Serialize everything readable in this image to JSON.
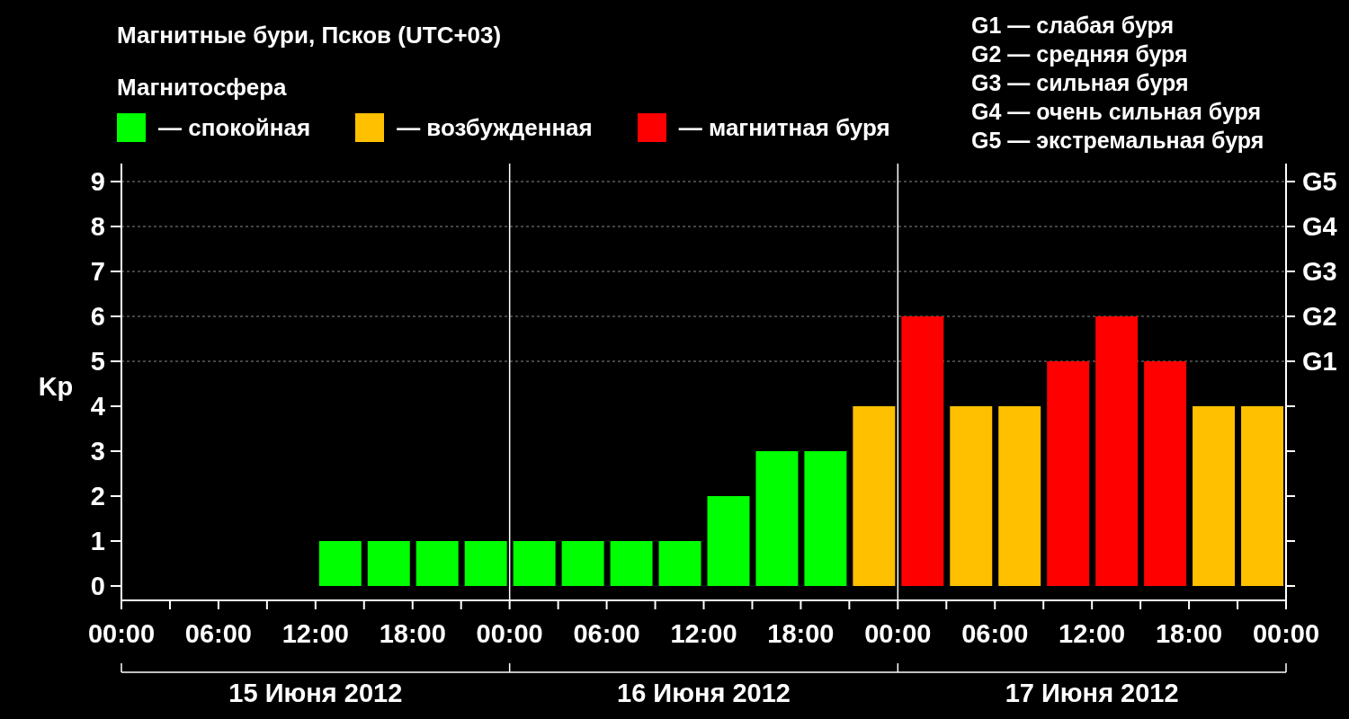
{
  "title": "Магнитные бури, Псков (UTC+03)",
  "legend_title": "Магнитосфера",
  "storm_levels": [
    "G1 — слабая буря",
    "G2 — средняя буря",
    "G3 — сильная буря",
    "G4 — очень сильная буря",
    "G5 — экстремальная буря"
  ],
  "storm_axis_labels": [
    "G5",
    "G4",
    "G3",
    "G2",
    "G1"
  ],
  "days": [
    "15 Июня 2012",
    "16 Июня 2012",
    "17 Июня 2012"
  ],
  "chart_data": {
    "type": "bar",
    "ylabel": "Kp",
    "grid": true,
    "x": [
      "2012-06-15T00:00",
      "2012-06-15T03:00",
      "2012-06-15T06:00",
      "2012-06-15T09:00",
      "2012-06-15T12:00",
      "2012-06-15T15:00",
      "2012-06-15T18:00",
      "2012-06-15T21:00",
      "2012-06-16T00:00",
      "2012-06-16T03:00",
      "2012-06-16T06:00",
      "2012-06-16T09:00",
      "2012-06-16T12:00",
      "2012-06-16T15:00",
      "2012-06-16T18:00",
      "2012-06-16T21:00",
      "2012-06-17T00:00",
      "2012-06-17T03:00",
      "2012-06-17T06:00",
      "2012-06-17T09:00",
      "2012-06-17T12:00",
      "2012-06-17T15:00",
      "2012-06-17T18:00",
      "2012-06-17T21:00"
    ],
    "xlim": [
      "2012-06-15T00:00",
      "2012-06-18T00:00"
    ],
    "ylim": [
      0,
      9
    ],
    "xticks": [
      {
        "value": "2012-06-15T00:00",
        "label": "00:00"
      },
      {
        "value": "2012-06-15T06:00",
        "label": "06:00"
      },
      {
        "value": "2012-06-15T12:00",
        "label": "12:00"
      },
      {
        "value": "2012-06-15T18:00",
        "label": "18:00"
      },
      {
        "value": "2012-06-16T00:00",
        "label": "00:00"
      },
      {
        "value": "2012-06-16T06:00",
        "label": "06:00"
      },
      {
        "value": "2012-06-16T12:00",
        "label": "12:00"
      },
      {
        "value": "2012-06-16T18:00",
        "label": "18:00"
      },
      {
        "value": "2012-06-17T00:00",
        "label": "00:00"
      },
      {
        "value": "2012-06-17T06:00",
        "label": "06:00"
      },
      {
        "value": "2012-06-17T12:00",
        "label": "12:00"
      },
      {
        "value": "2012-06-17T18:00",
        "label": "18:00"
      },
      {
        "value": "2012-06-18T00:00",
        "label": "00:00"
      }
    ],
    "yticks": [
      0,
      1,
      2,
      3,
      4,
      5,
      6,
      7,
      8,
      9
    ],
    "series": [
      {
        "name": "— спокойная",
        "color": "#00ff00",
        "values": [
          0,
          0,
          0,
          0,
          1,
          1,
          1,
          1,
          1,
          1,
          1,
          1,
          2,
          3,
          3,
          null,
          null,
          null,
          null,
          null,
          null,
          null,
          null,
          null
        ]
      },
      {
        "name": "— возбужденная",
        "color": "#ffc000",
        "values": [
          null,
          null,
          null,
          null,
          null,
          null,
          null,
          null,
          null,
          null,
          null,
          null,
          null,
          null,
          null,
          4,
          null,
          4,
          4,
          null,
          null,
          null,
          4,
          4
        ]
      },
      {
        "name": "— магнитная буря",
        "color": "#ff0000",
        "values": [
          null,
          null,
          null,
          null,
          null,
          null,
          null,
          null,
          null,
          null,
          null,
          null,
          null,
          null,
          null,
          null,
          6,
          null,
          null,
          5,
          6,
          5,
          null,
          null
        ]
      }
    ]
  }
}
